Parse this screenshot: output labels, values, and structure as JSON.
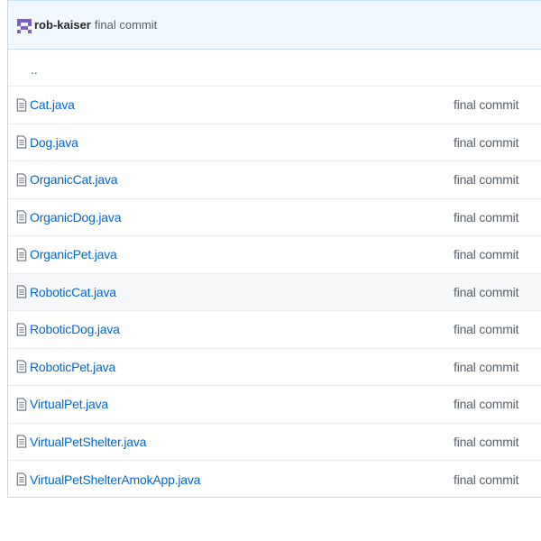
{
  "commit": {
    "author": "rob-kaiser",
    "message": "final commit"
  },
  "parent_dir": "..",
  "files": [
    {
      "name": "Cat.java",
      "message": "final commit"
    },
    {
      "name": "Dog.java",
      "message": "final commit"
    },
    {
      "name": "OrganicCat.java",
      "message": "final commit"
    },
    {
      "name": "OrganicDog.java",
      "message": "final commit"
    },
    {
      "name": "OrganicPet.java",
      "message": "final commit"
    },
    {
      "name": "RoboticCat.java",
      "message": "final commit"
    },
    {
      "name": "RoboticDog.java",
      "message": "final commit"
    },
    {
      "name": "RoboticPet.java",
      "message": "final commit"
    },
    {
      "name": "VirtualPet.java",
      "message": "final commit"
    },
    {
      "name": "VirtualPetShelter.java",
      "message": "final commit"
    },
    {
      "name": "VirtualPetShelterAmokApp.java",
      "message": "final commit"
    }
  ],
  "colors": {
    "link": "#0366d6",
    "muted": "#586069",
    "header_bg": "#f1f8ff",
    "avatar": "#6f42c1"
  },
  "icons": {
    "avatar": "identicon-avatar",
    "file": "file-icon"
  }
}
